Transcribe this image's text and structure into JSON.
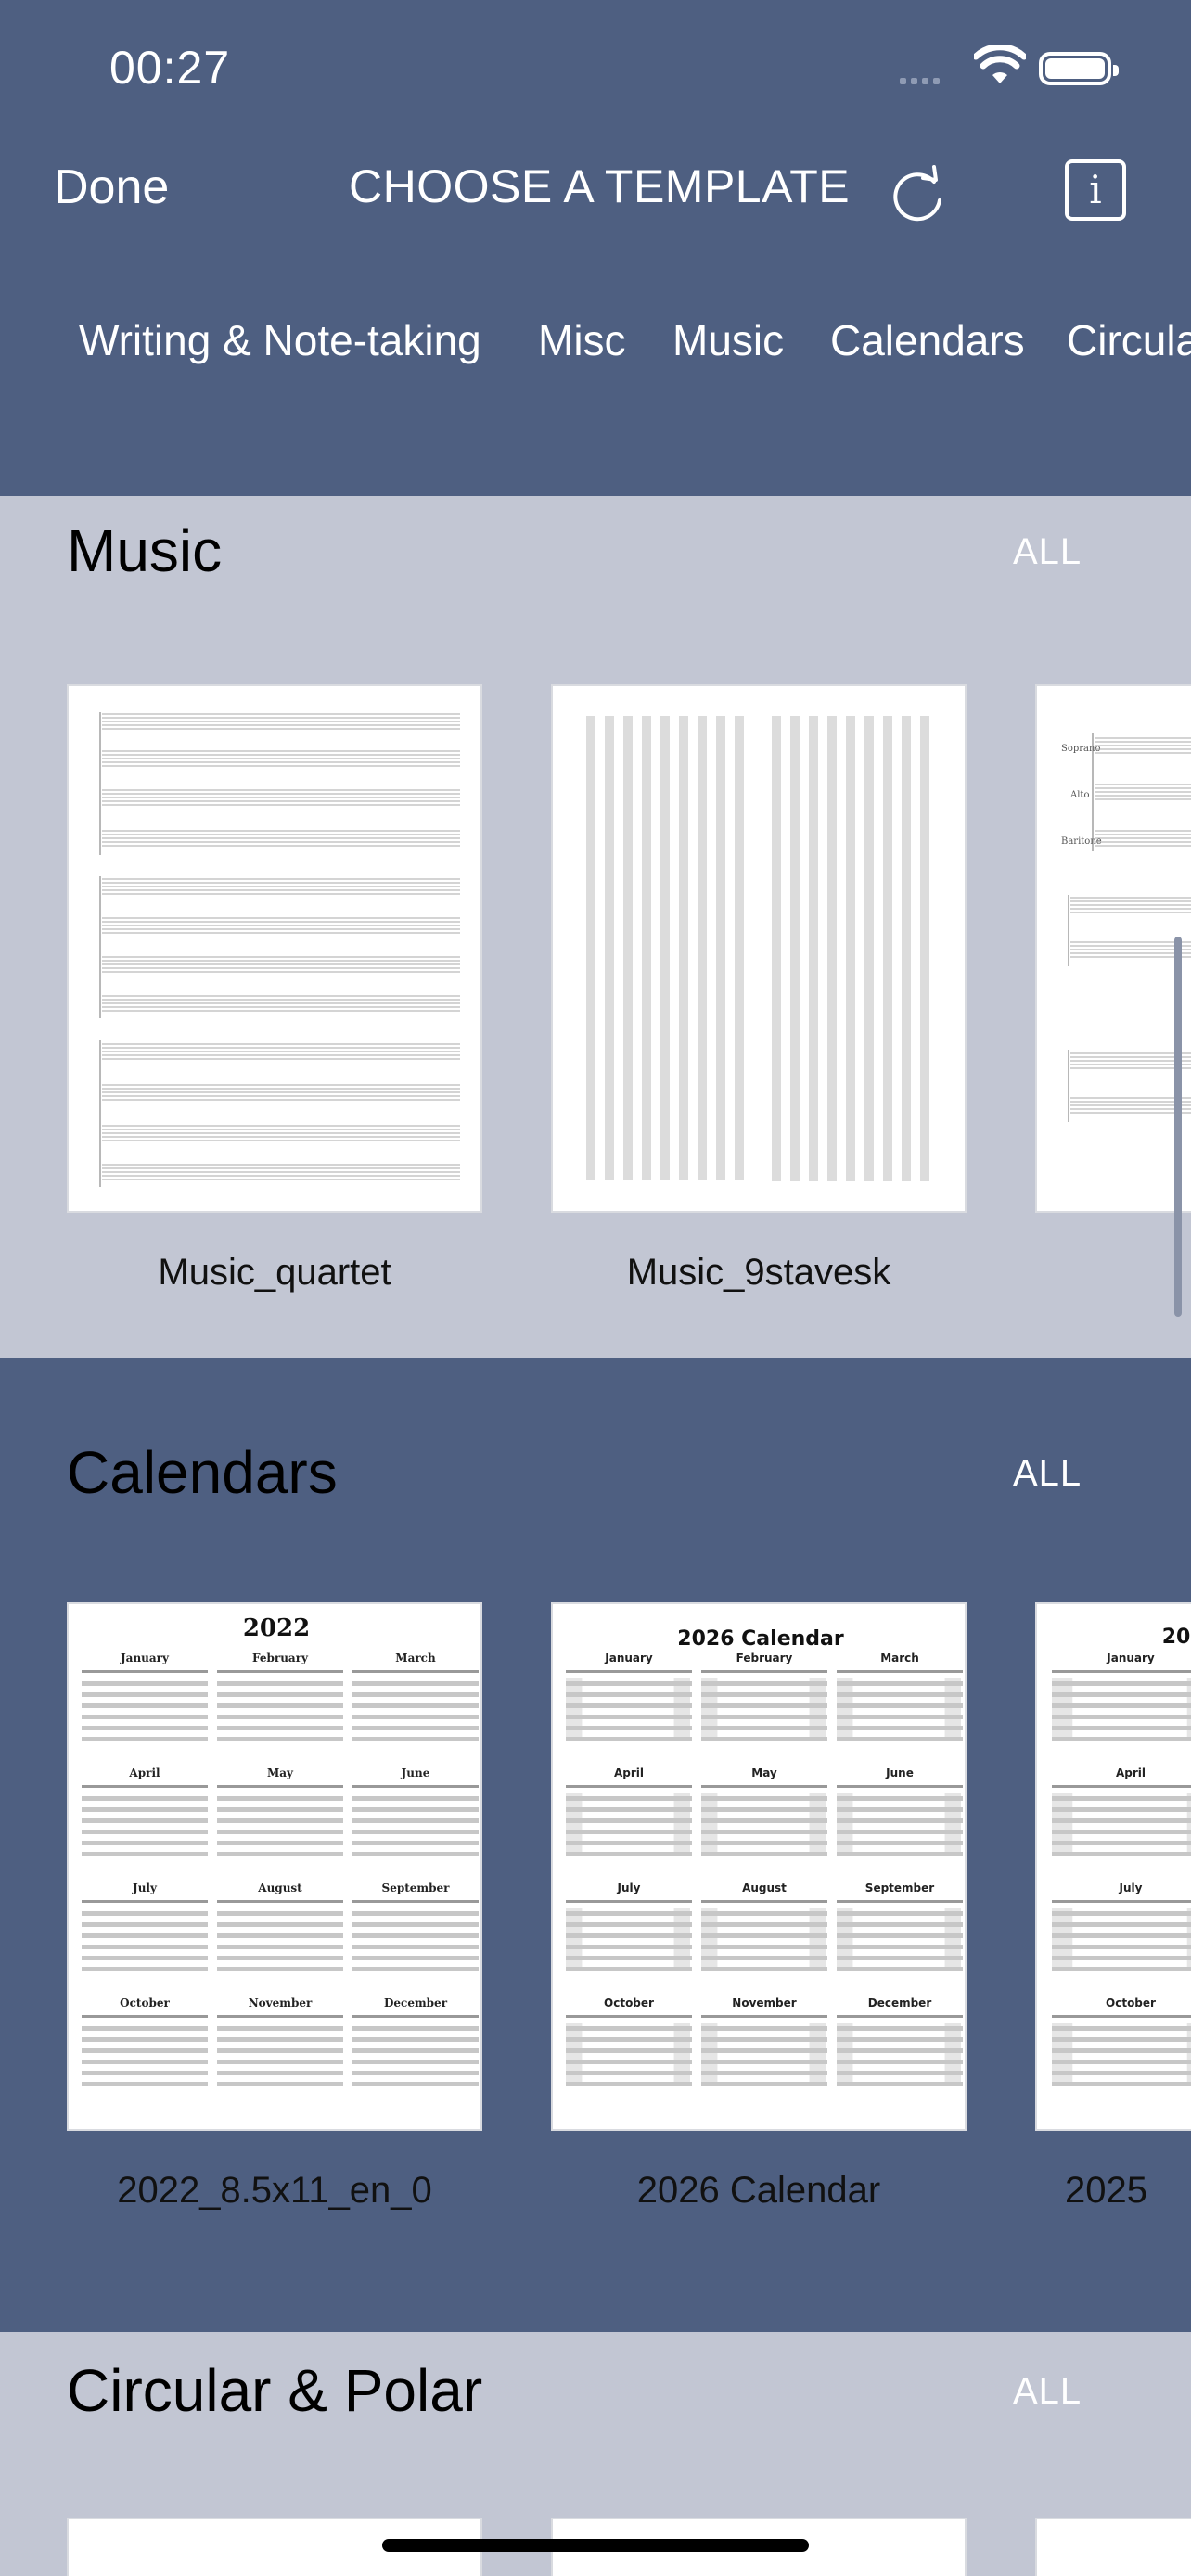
{
  "status_bar": {
    "time": "00:27",
    "icons": [
      "signal-icon",
      "wifi-icon",
      "battery-icon"
    ]
  },
  "header": {
    "done_label": "Done",
    "title": "CHOOSE A TEMPLATE",
    "refresh_icon": "refresh-icon",
    "info_icon": "info-icon",
    "info_glyph": "i"
  },
  "tabs": [
    {
      "label": "Writing & Note-taking"
    },
    {
      "label": "Misc"
    },
    {
      "label": "Music"
    },
    {
      "label": "Calendars"
    },
    {
      "label": "Circula"
    }
  ],
  "sections": {
    "music": {
      "title": "Music",
      "all_label": "ALL",
      "items": [
        {
          "caption": "Music_quartet"
        },
        {
          "caption": "Music_9stavesk"
        },
        {
          "caption": "",
          "labels": [
            "Soprano",
            "Alto",
            "Baritone"
          ]
        }
      ]
    },
    "calendars": {
      "title": "Calendars",
      "all_label": "ALL",
      "items": [
        {
          "caption": "2022_8.5x11_en_0",
          "heading": "2022"
        },
        {
          "caption": "2026 Calendar",
          "heading": "2026 Calendar"
        },
        {
          "caption": "2025",
          "heading": "20"
        }
      ],
      "months": [
        "January",
        "February",
        "March",
        "April",
        "May",
        "June",
        "July",
        "August",
        "September",
        "October",
        "November",
        "December"
      ]
    },
    "circular": {
      "title": "Circular & Polar",
      "all_label": "ALL"
    }
  },
  "colors": {
    "header_bg": "#4e5f81",
    "section_light": "#c2c6d3",
    "section_dark": "#4e5f81"
  }
}
